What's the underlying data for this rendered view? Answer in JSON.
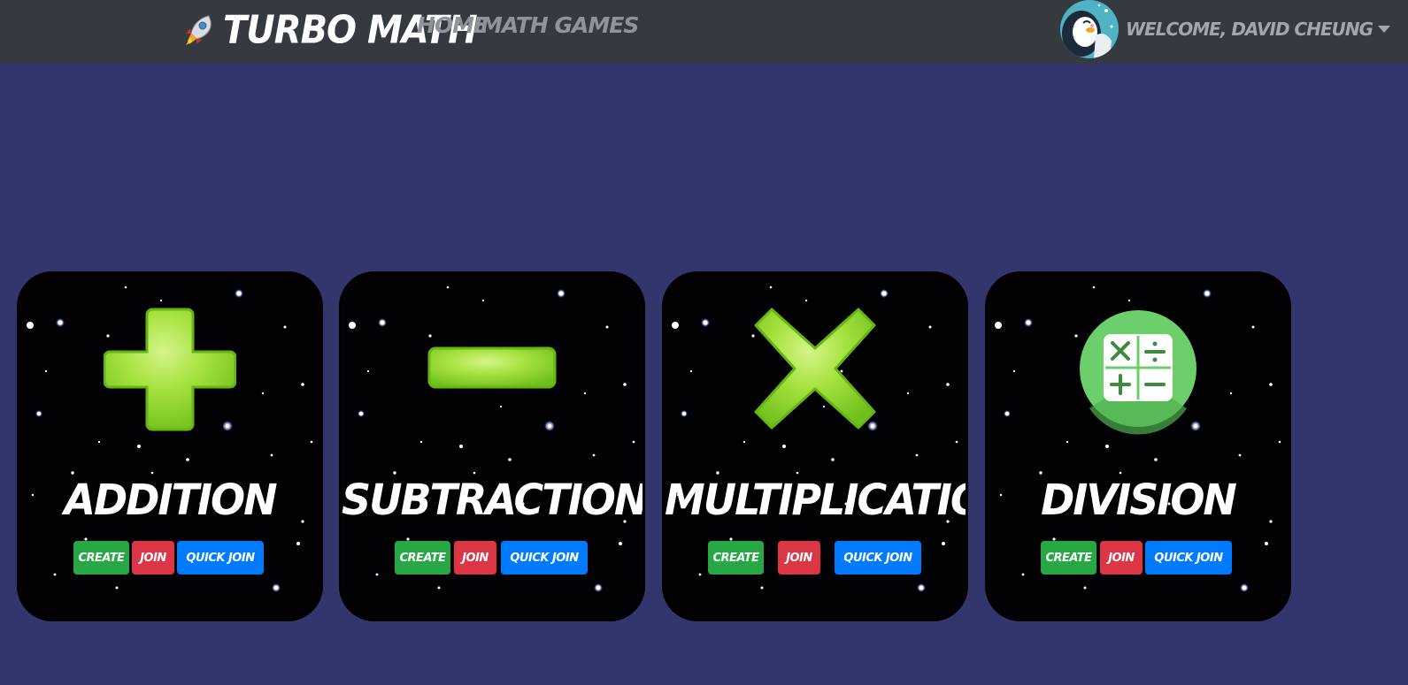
{
  "navbar": {
    "brand": "TURBO MATH",
    "links": [
      "HOME",
      "MATH GAMES"
    ],
    "welcome": "WELCOME, DAVID CHEUNG"
  },
  "cards": [
    {
      "title": "ADDITION",
      "icon": "plus-icon",
      "create": "CREATE",
      "join": "JOIN",
      "quick_join": "QUICK JOIN"
    },
    {
      "title": "SUBTRACTION",
      "icon": "minus-icon",
      "create": "CREATE",
      "join": "JOIN",
      "quick_join": "QUICK JOIN"
    },
    {
      "title": "MULTIPLICATION",
      "icon": "times-icon",
      "create": "CREATE",
      "join": "JOIN",
      "quick_join": "QUICK JOIN"
    },
    {
      "title": "DIVISION",
      "icon": "calculator-icon",
      "create": "CREATE",
      "join": "JOIN",
      "quick_join": "QUICK JOIN"
    }
  ],
  "colors": {
    "page_bg": "#32366c",
    "navbar_bg": "#343a40",
    "create": "#28a745",
    "join": "#dc3545",
    "quick_join": "#007bff",
    "icon_green": "#9ee03a"
  }
}
